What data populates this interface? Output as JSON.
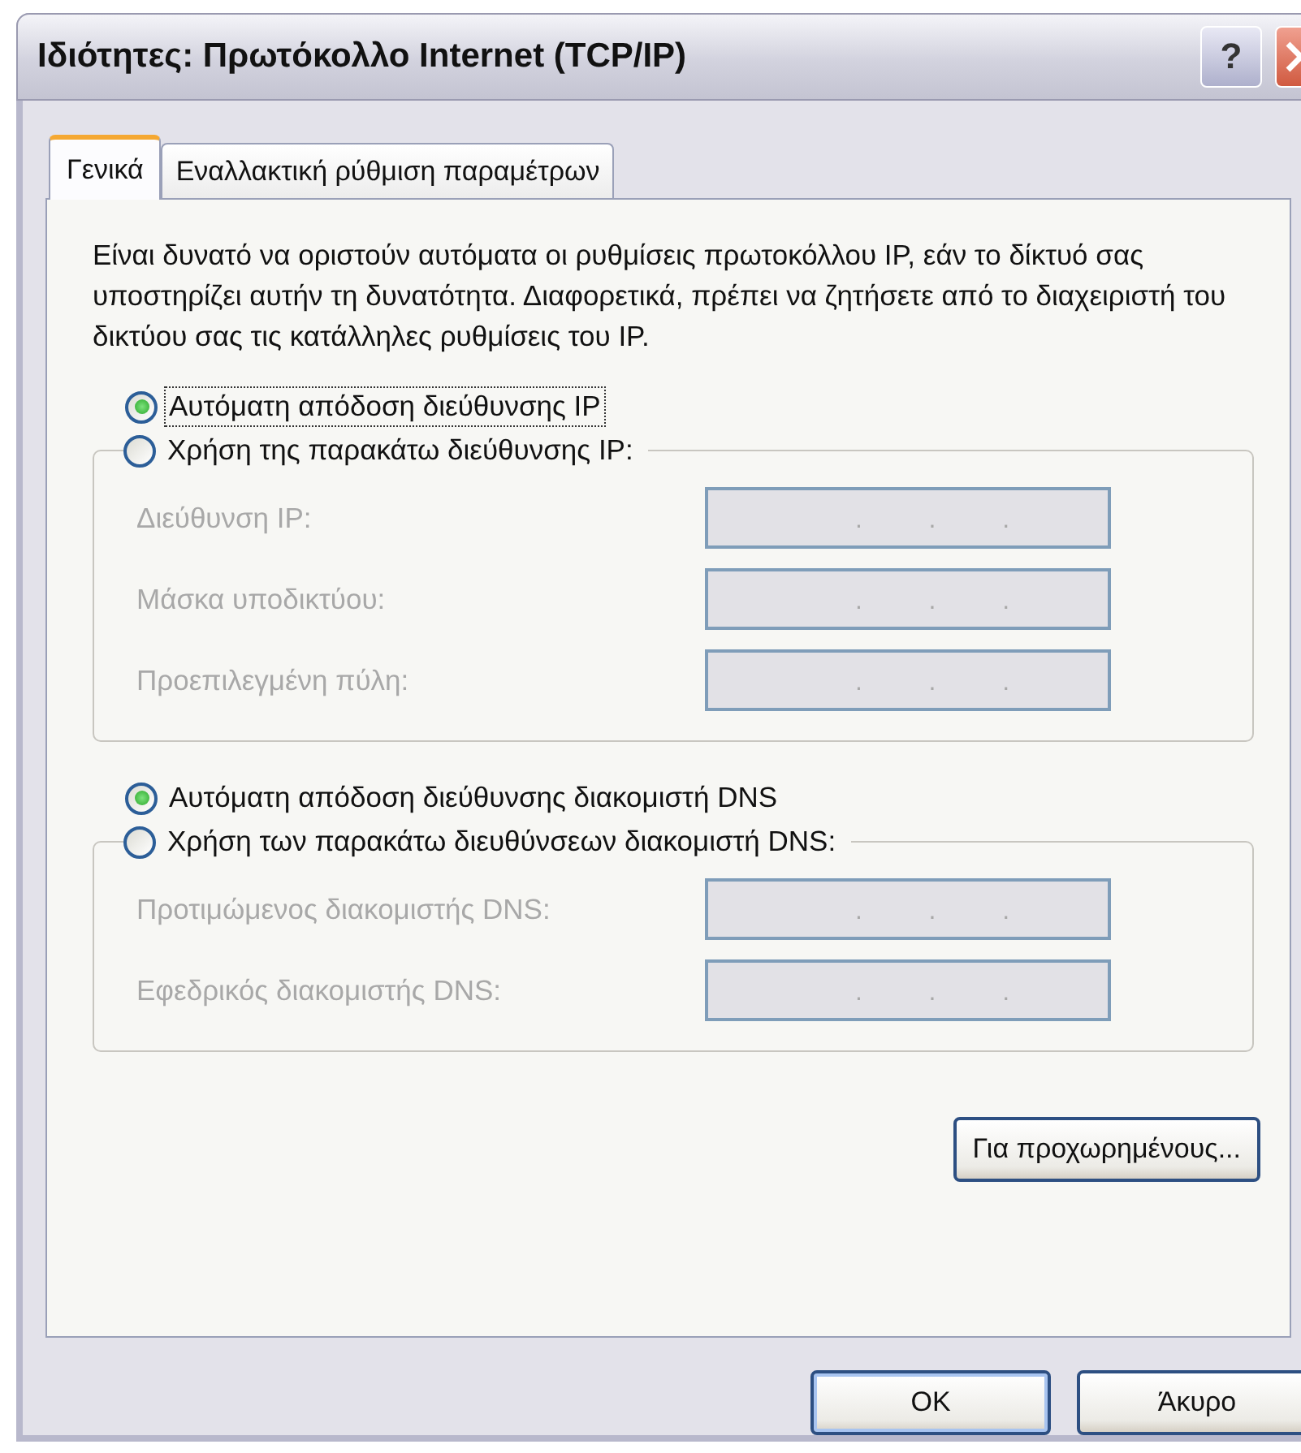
{
  "window": {
    "title": "Ιδιότητες: Πρωτόκολλο Internet (TCP/IP)",
    "help_button": "?"
  },
  "tabs": [
    {
      "label": "Γενικά",
      "selected": true
    },
    {
      "label": "Εναλλακτική ρύθμιση παραμέτρων",
      "selected": false
    }
  ],
  "description": "Είναι δυνατό να οριστούν αυτόματα οι ρυθμίσεις πρωτοκόλλου IP, εάν το δίκτυό σας υποστηρίζει αυτήν τη δυνατότητα. Διαφορετικά, πρέπει να ζητήσετε από το διαχειριστή του δικτύου σας τις κατάλληλες ρυθμίσεις του IP.",
  "sections": [
    {
      "auto_option": {
        "label": "Αυτόματη απόδοση διεύθυνσης IP",
        "selected": true,
        "focused": true
      },
      "manual_option": {
        "label": "Χρήση της παρακάτω διεύθυνσης IP:",
        "selected": false
      },
      "fields": [
        {
          "label": "Διεύθυνση IP:",
          "disabled": true,
          "dots": [
            ".",
            ".",
            "."
          ]
        },
        {
          "label": "Μάσκα υποδικτύου:",
          "disabled": true,
          "dots": [
            ".",
            ".",
            "."
          ]
        },
        {
          "label": "Προεπιλεγμένη πύλη:",
          "disabled": true,
          "dots": [
            ".",
            ".",
            "."
          ]
        }
      ]
    },
    {
      "auto_option": {
        "label": "Αυτόματη απόδοση διεύθυνσης διακομιστή DNS",
        "selected": true,
        "focused": false
      },
      "manual_option": {
        "label": "Χρήση των παρακάτω διευθύνσεων διακομιστή DNS:",
        "selected": false
      },
      "fields": [
        {
          "label": "Προτιμώμενος διακομιστής DNS:",
          "disabled": true,
          "dots": [
            ".",
            ".",
            "."
          ]
        },
        {
          "label": "Εφεδρικός διακομιστής DNS:",
          "disabled": true,
          "dots": [
            ".",
            ".",
            "."
          ]
        }
      ]
    }
  ],
  "advanced_button": "Για προχωρημένους...",
  "buttons": [
    {
      "label": "OK",
      "default": true
    },
    {
      "label": "Άκυρο",
      "default": false
    }
  ]
}
